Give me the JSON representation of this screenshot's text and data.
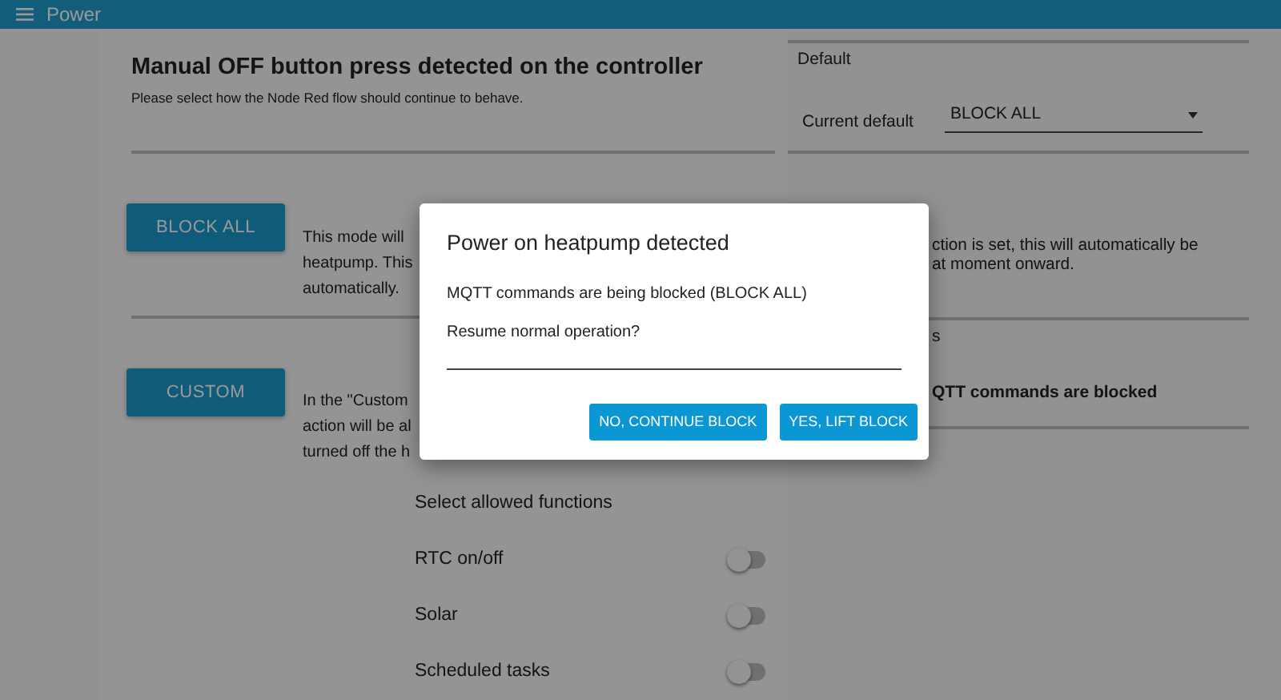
{
  "app_bar": {
    "title": "Power"
  },
  "left_panel": {
    "title": "Manual OFF button press detected on the controller",
    "subtitle": "Please select how the Node Red flow should continue to behave.",
    "modes": [
      {
        "button": "BLOCK ALL",
        "description_lines": [
          "This mode will",
          "heatpump. This",
          "automatically."
        ]
      },
      {
        "button": "CUSTOM",
        "description_lines": [
          "In the \"Custom",
          "action will be al",
          "turned off the h"
        ]
      }
    ],
    "functions_heading": "Select allowed functions",
    "functions": [
      {
        "label": "RTC on/off",
        "on": false
      },
      {
        "label": "Solar",
        "on": false
      },
      {
        "label": "Scheduled tasks",
        "on": false
      }
    ]
  },
  "right_panel": {
    "default_heading": "Default",
    "default_label": "Current default",
    "default_value": "BLOCK ALL",
    "note_lines": [
      "ction is set, this will automatically be",
      "at moment onward."
    ],
    "status_heading": "s",
    "status_text": "QTT commands are blocked"
  },
  "dialog": {
    "title": "Power on heatpump detected",
    "lines": [
      "MQTT commands are being blocked (BLOCK ALL)",
      "Resume normal operation?"
    ],
    "buttons": [
      "NO, CONTINUE BLOCK",
      "YES, LIFT BLOCK"
    ]
  }
}
